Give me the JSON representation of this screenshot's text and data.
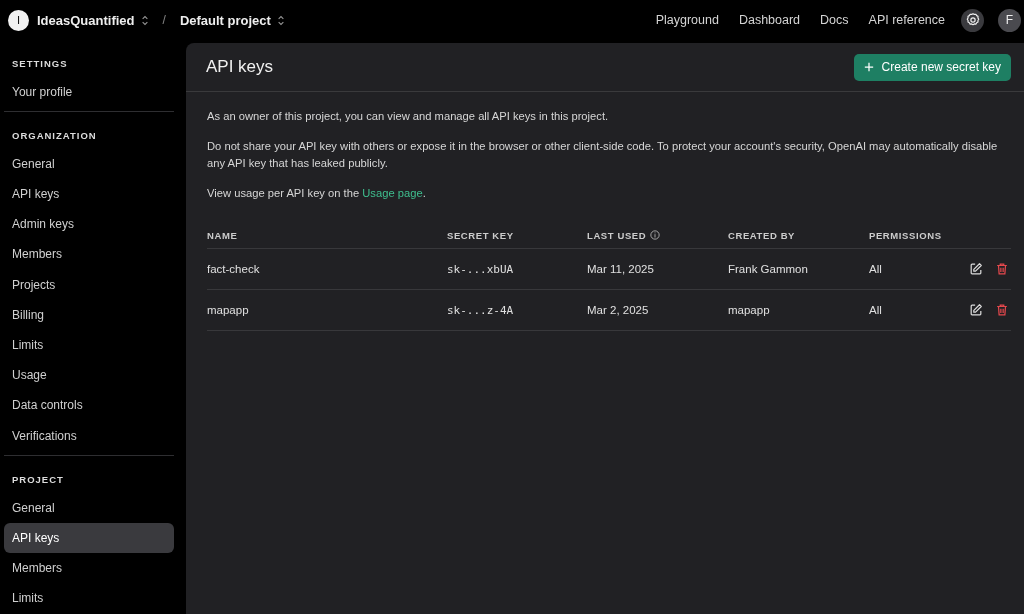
{
  "topbar": {
    "org": {
      "initial": "I",
      "name": "IdeasQuantified"
    },
    "separator": "/",
    "project": "Default project",
    "nav": [
      "Playground",
      "Dashboard",
      "Docs",
      "API reference"
    ],
    "avatar": "F"
  },
  "sidebar": [
    {
      "heading": "SETTINGS",
      "items": [
        {
          "label": "Your profile",
          "selected": false
        }
      ]
    },
    {
      "heading": "ORGANIZATION",
      "items": [
        {
          "label": "General",
          "selected": false
        },
        {
          "label": "API keys",
          "selected": false
        },
        {
          "label": "Admin keys",
          "selected": false
        },
        {
          "label": "Members",
          "selected": false
        },
        {
          "label": "Projects",
          "selected": false
        },
        {
          "label": "Billing",
          "selected": false
        },
        {
          "label": "Limits",
          "selected": false
        },
        {
          "label": "Usage",
          "selected": false
        },
        {
          "label": "Data controls",
          "selected": false
        },
        {
          "label": "Verifications",
          "selected": false
        }
      ]
    },
    {
      "heading": "PROJECT",
      "items": [
        {
          "label": "General",
          "selected": false
        },
        {
          "label": "API keys",
          "selected": true
        },
        {
          "label": "Members",
          "selected": false
        },
        {
          "label": "Limits",
          "selected": false
        }
      ]
    }
  ],
  "page": {
    "title": "API keys",
    "create_button": "Create new secret key",
    "intro": "As an owner of this project, you can view and manage all API keys in this project.",
    "warning": "Do not share your API key with others or expose it in the browser or other client-side code. To protect your account's security, OpenAI may automatically disable any API key that has leaked publicly.",
    "usage_note": {
      "before": "View usage per API key on the",
      "link": "Usage page",
      "after": "."
    }
  },
  "table": {
    "columns": [
      {
        "label": "NAME",
        "info": false
      },
      {
        "label": "SECRET KEY",
        "info": false
      },
      {
        "label": "LAST USED",
        "info": true
      },
      {
        "label": "CREATED BY",
        "info": false
      },
      {
        "label": "PERMISSIONS",
        "info": false
      }
    ],
    "rows": [
      {
        "name": "fact-check",
        "secret_key": "sk-...xbUA",
        "last_used": "Mar 11, 2025",
        "created_by": "Frank Gammon",
        "permissions": "All"
      },
      {
        "name": "mapapp",
        "secret_key": "sk-...z-4A",
        "last_used": "Mar 2, 2025",
        "created_by": "mapapp",
        "permissions": "All"
      }
    ]
  }
}
